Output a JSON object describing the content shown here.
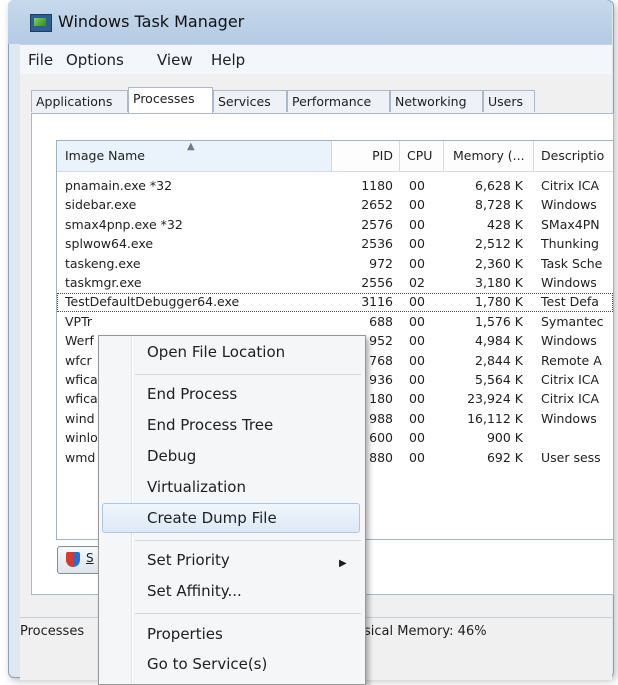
{
  "window": {
    "title": "Windows Task Manager",
    "icon": "task-manager-icon"
  },
  "menu": [
    "File",
    "Options",
    "View",
    "Help"
  ],
  "tabs": [
    "Applications",
    "Processes",
    "Services",
    "Performance",
    "Networking",
    "Users"
  ],
  "active_tab": "Processes",
  "table": {
    "columns": [
      "Image Name",
      "PID",
      "CPU",
      "Memory (...",
      "Descriptio"
    ],
    "sorted_column": "Image Name",
    "rows": [
      {
        "name": "pnamain.exe *32",
        "pid": "1180",
        "cpu": "00",
        "mem": "6,628 K",
        "desc": "Citrix ICA"
      },
      {
        "name": "sidebar.exe",
        "pid": "2652",
        "cpu": "00",
        "mem": "8,728 K",
        "desc": "Windows"
      },
      {
        "name": "smax4pnp.exe *32",
        "pid": "2576",
        "cpu": "00",
        "mem": "428 K",
        "desc": "SMax4PN"
      },
      {
        "name": "splwow64.exe",
        "pid": "2536",
        "cpu": "00",
        "mem": "2,512 K",
        "desc": "Thunking"
      },
      {
        "name": "taskeng.exe",
        "pid": "972",
        "cpu": "00",
        "mem": "2,360 K",
        "desc": "Task Sche"
      },
      {
        "name": "taskmgr.exe",
        "pid": "2556",
        "cpu": "02",
        "mem": "3,180 K",
        "desc": "Windows"
      },
      {
        "name": "TestDefaultDebugger64.exe",
        "pid": "3116",
        "cpu": "00",
        "mem": "1,780 K",
        "desc": "Test Defa"
      },
      {
        "name": "VPTr",
        "pid": "688",
        "cpu": "00",
        "mem": "1,576 K",
        "desc": "Symantec"
      },
      {
        "name": "Werf",
        "pid": "952",
        "cpu": "00",
        "mem": "4,984 K",
        "desc": "Windows"
      },
      {
        "name": "wfcr",
        "pid": "768",
        "cpu": "00",
        "mem": "2,844 K",
        "desc": "Remote A"
      },
      {
        "name": "wfica",
        "pid": "936",
        "cpu": "00",
        "mem": "5,564 K",
        "desc": "Citrix ICA"
      },
      {
        "name": "wfica",
        "pid": "180",
        "cpu": "00",
        "mem": "23,924 K",
        "desc": "Citrix ICA"
      },
      {
        "name": "wind",
        "pid": "988",
        "cpu": "00",
        "mem": "16,112 K",
        "desc": "Windows"
      },
      {
        "name": "winlo",
        "pid": "600",
        "cpu": "00",
        "mem": "900 K",
        "desc": ""
      },
      {
        "name": "wmd",
        "pid": "880",
        "cpu": "00",
        "mem": "692 K",
        "desc": "User sess"
      }
    ]
  },
  "services_button": {
    "label": "S",
    "icon": "shield-icon"
  },
  "status": {
    "processes": "Processes",
    "memory": "sical Memory: 46%"
  },
  "context_menu": {
    "items": [
      "Open File Location",
      "End Process",
      "End Process Tree",
      "Debug",
      "Virtualization",
      "Create Dump File",
      "Set Priority",
      "Set Affinity...",
      "Properties",
      "Go to Service(s)"
    ],
    "highlighted": "Create Dump File",
    "submenu_item": "Set Priority"
  }
}
